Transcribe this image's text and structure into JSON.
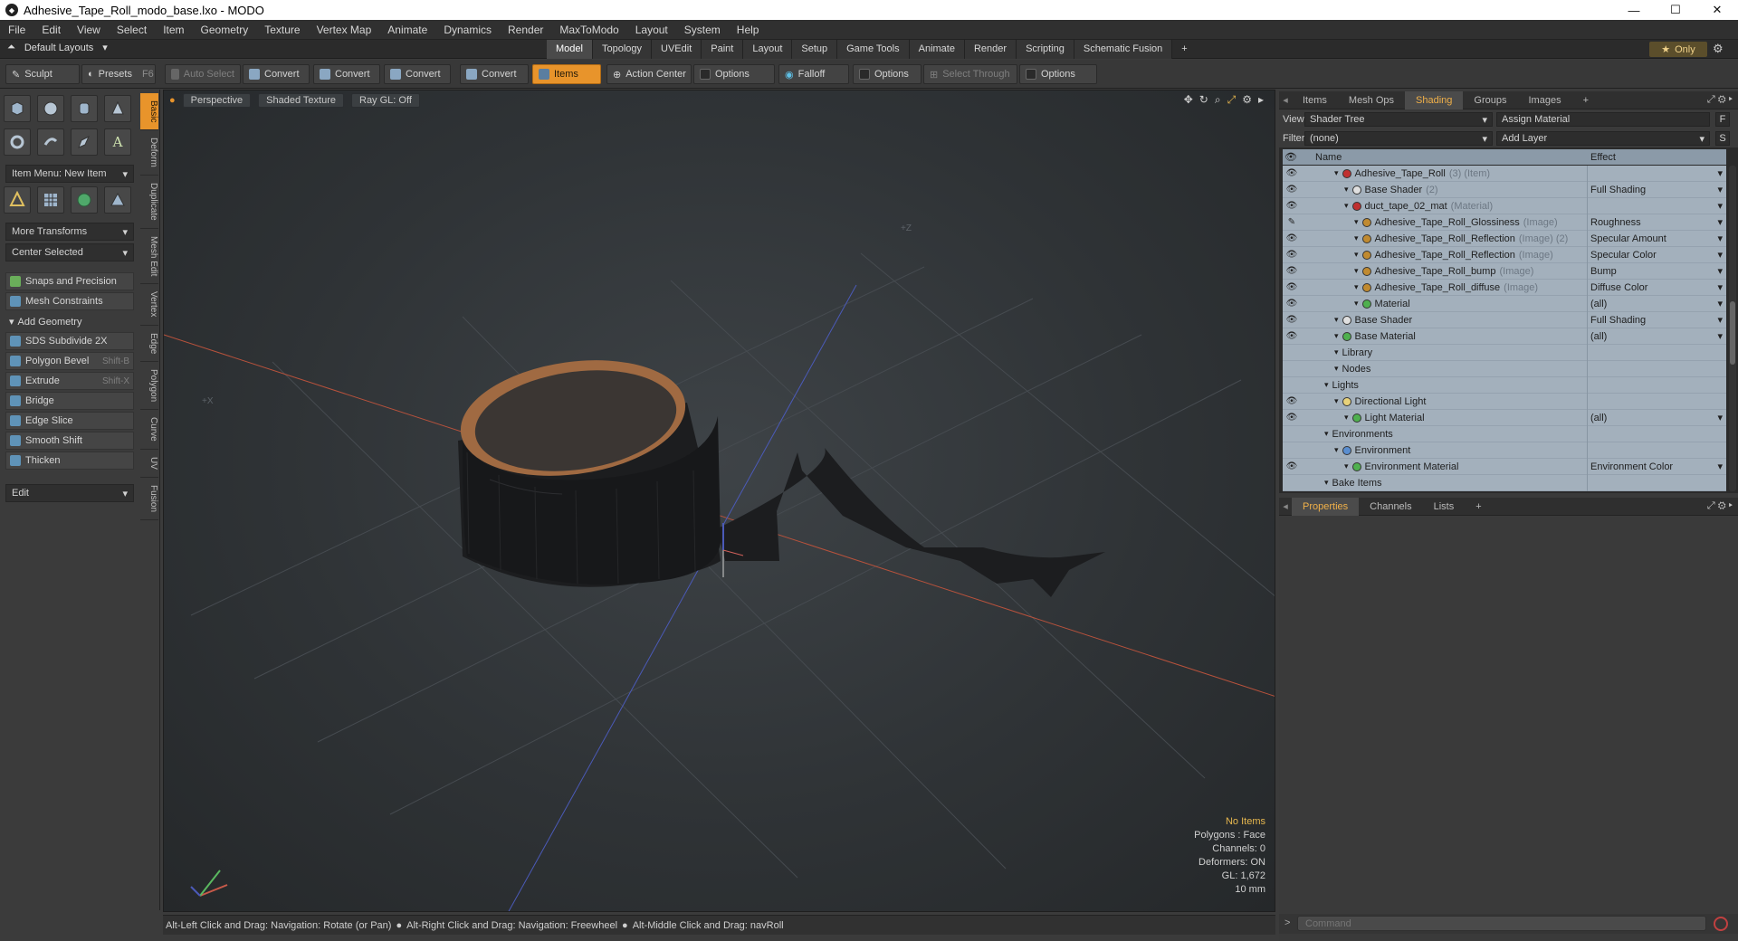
{
  "window": {
    "title": "Adhesive_Tape_Roll_modo_base.lxo - MODO",
    "minimize": "—",
    "maximize": "☐",
    "close": "✕"
  },
  "menu": [
    "File",
    "Edit",
    "View",
    "Select",
    "Item",
    "Geometry",
    "Texture",
    "Vertex Map",
    "Animate",
    "Dynamics",
    "Render",
    "MaxToModo",
    "Layout",
    "System",
    "Help"
  ],
  "layouts": {
    "label": "Default Layouts"
  },
  "mode_tabs": [
    "Model",
    "Topology",
    "UVEdit",
    "Paint",
    "Layout",
    "Setup",
    "Game Tools",
    "Animate",
    "Render",
    "Scripting",
    "Schematic Fusion",
    "+"
  ],
  "only_label": "Only",
  "toolbar": {
    "sculpt": "Sculpt",
    "presets": "Presets",
    "presets_hotkey": "F6",
    "auto_select": "Auto Select",
    "convert1": "Convert",
    "convert2": "Convert",
    "convert3": "Convert",
    "convert4": "Convert",
    "items": "Items",
    "action_center": "Action Center",
    "options1": "Options",
    "falloff": "Falloff",
    "options2": "Options",
    "select_through": "Select Through",
    "options3": "Options"
  },
  "left": {
    "vtabs": [
      "Basic",
      "Deform",
      "Duplicate",
      "Mesh Edit",
      "Vertex",
      "Edge",
      "Polygon",
      "Curve",
      "UV",
      "Fusion"
    ],
    "item_menu": "Item Menu: New Item",
    "more_transforms": "More Transforms",
    "center_selected": "Center Selected",
    "snaps": "Snaps and Precision",
    "mesh_constraints": "Mesh Constraints",
    "add_geometry": "Add Geometry",
    "tools": [
      {
        "label": "SDS Subdivide 2X",
        "hotkey": ""
      },
      {
        "label": "Polygon Bevel",
        "hotkey": "Shift-B"
      },
      {
        "label": "Extrude",
        "hotkey": "Shift-X"
      },
      {
        "label": "Bridge",
        "hotkey": ""
      },
      {
        "label": "Edge Slice",
        "hotkey": ""
      },
      {
        "label": "Smooth Shift",
        "hotkey": ""
      },
      {
        "label": "Thicken",
        "hotkey": ""
      }
    ],
    "edit": "Edit"
  },
  "viewport": {
    "perspective": "Perspective",
    "shading": "Shaded Texture",
    "raygl": "Ray GL: Off",
    "axis_z": "+Z",
    "axis_x": "+X",
    "info": {
      "no_items": "No Items",
      "polygons": "Polygons : Face",
      "channels": "Channels: 0",
      "deformers": "Deformers: ON",
      "gl": "GL: 1,672",
      "scale": "10 mm"
    }
  },
  "status": {
    "hint1": "Alt-Left Click and Drag: Navigation: Rotate (or Pan)",
    "hint2": "Alt-Right Click and Drag: Navigation: Freewheel",
    "hint3": "Alt-Middle Click and Drag: navRoll"
  },
  "right": {
    "tabs": [
      "Items",
      "Mesh Ops",
      "Shading",
      "Groups",
      "Images",
      "+"
    ],
    "view_label": "View",
    "view_value": "Shader Tree",
    "assign_material": "Assign Material",
    "f_btn": "F",
    "filter_label": "Filter",
    "filter_value": "(none)",
    "add_layer": "Add Layer",
    "s_btn": "S",
    "col_name": "Name",
    "col_effect": "Effect",
    "tree": [
      {
        "name": "Adhesive_Tape_Roll",
        "tag": "(3) (Item)",
        "effect": "",
        "eye": "👁",
        "indent": 0,
        "dot": "#c03030"
      },
      {
        "name": "Base Shader",
        "tag": "(2)",
        "effect": "Full Shading",
        "eye": "👁",
        "indent": 1,
        "dot": "#e0e0e0"
      },
      {
        "name": "duct_tape_02_mat",
        "tag": "(Material)",
        "effect": "",
        "eye": "👁",
        "indent": 1,
        "dot": "#c03030"
      },
      {
        "name": "Adhesive_Tape_Roll_Glossiness",
        "tag": "(Image)",
        "effect": "Roughness",
        "eye": "✎",
        "indent": 2,
        "dot": "#c08a30"
      },
      {
        "name": "Adhesive_Tape_Roll_Reflection",
        "tag": "(Image) (2)",
        "effect": "Specular Amount",
        "eye": "👁",
        "indent": 2,
        "dot": "#c08a30"
      },
      {
        "name": "Adhesive_Tape_Roll_Reflection",
        "tag": "(Image)",
        "effect": "Specular Color",
        "eye": "👁",
        "indent": 2,
        "dot": "#c08a30"
      },
      {
        "name": "Adhesive_Tape_Roll_bump",
        "tag": "(Image)",
        "effect": "Bump",
        "eye": "👁",
        "indent": 2,
        "dot": "#c08a30"
      },
      {
        "name": "Adhesive_Tape_Roll_diffuse",
        "tag": "(Image)",
        "effect": "Diffuse Color",
        "eye": "👁",
        "indent": 2,
        "dot": "#c08a30"
      },
      {
        "name": "Material",
        "tag": "",
        "effect": "(all)",
        "eye": "👁",
        "indent": 2,
        "dot": "#4fb04f"
      },
      {
        "name": "Base Shader",
        "tag": "",
        "effect": "Full Shading",
        "eye": "👁",
        "indent": 0,
        "dot": "#e0e0e0"
      },
      {
        "name": "Base Material",
        "tag": "",
        "effect": "(all)",
        "eye": "👁",
        "indent": 0,
        "dot": "#4fb04f"
      },
      {
        "name": "Library",
        "tag": "",
        "effect": "",
        "eye": "",
        "indent": 0,
        "dot": ""
      },
      {
        "name": "Nodes",
        "tag": "",
        "effect": "",
        "eye": "",
        "indent": 0,
        "dot": ""
      },
      {
        "name": "Lights",
        "tag": "",
        "effect": "",
        "eye": "",
        "indent": -1,
        "dot": ""
      },
      {
        "name": "Directional Light",
        "tag": "",
        "effect": "",
        "eye": "👁",
        "indent": 0,
        "dot": "#e8d27a"
      },
      {
        "name": "Light Material",
        "tag": "",
        "effect": "(all)",
        "eye": "👁",
        "indent": 1,
        "dot": "#4fb04f"
      },
      {
        "name": "Environments",
        "tag": "",
        "effect": "",
        "eye": "",
        "indent": -1,
        "dot": ""
      },
      {
        "name": "Environment",
        "tag": "",
        "effect": "",
        "eye": "",
        "indent": 0,
        "dot": "#5a8ed0"
      },
      {
        "name": "Environment Material",
        "tag": "",
        "effect": "Environment Color",
        "eye": "👁",
        "indent": 1,
        "dot": "#4fb04f"
      },
      {
        "name": "Bake Items",
        "tag": "",
        "effect": "",
        "eye": "",
        "indent": -1,
        "dot": ""
      }
    ],
    "prop_tabs": [
      "Properties",
      "Channels",
      "Lists",
      "+"
    ],
    "command_placeholder": "Command"
  },
  "colors": {
    "accent": "#e8942b",
    "tree_bg": "#a3b0bc",
    "tree_header": "#8b9aa8"
  }
}
